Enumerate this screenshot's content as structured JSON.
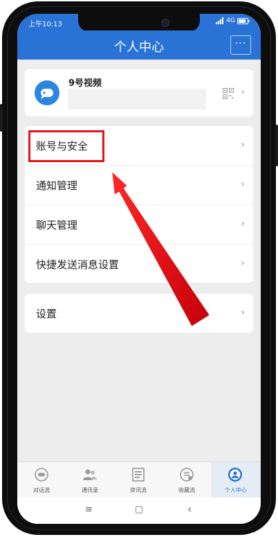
{
  "status_bar": {
    "time": "上午10:13",
    "network": "4G"
  },
  "header": {
    "title": "个人中心",
    "more_label": "···"
  },
  "profile": {
    "name": "9号视频",
    "chevron": "›"
  },
  "menu": {
    "items": [
      {
        "label": "账号与安全"
      },
      {
        "label": "通知管理"
      },
      {
        "label": "聊天管理"
      },
      {
        "label": "快捷发送消息设置"
      }
    ]
  },
  "settings": {
    "label": "设置"
  },
  "chevron": "›",
  "tabs": [
    {
      "label": "对话流",
      "icon": "chat-bubble-icon"
    },
    {
      "label": "通讯录",
      "icon": "contacts-icon"
    },
    {
      "label": "资讯流",
      "icon": "news-icon"
    },
    {
      "label": "收藏流",
      "icon": "favorites-icon"
    },
    {
      "label": "个人中心",
      "icon": "person-icon",
      "active": true
    }
  ],
  "nav": {
    "menu": "≡",
    "home": "▢",
    "back": "‹"
  },
  "colors": {
    "accent": "#2a73d6",
    "highlight": "#e8101a"
  }
}
